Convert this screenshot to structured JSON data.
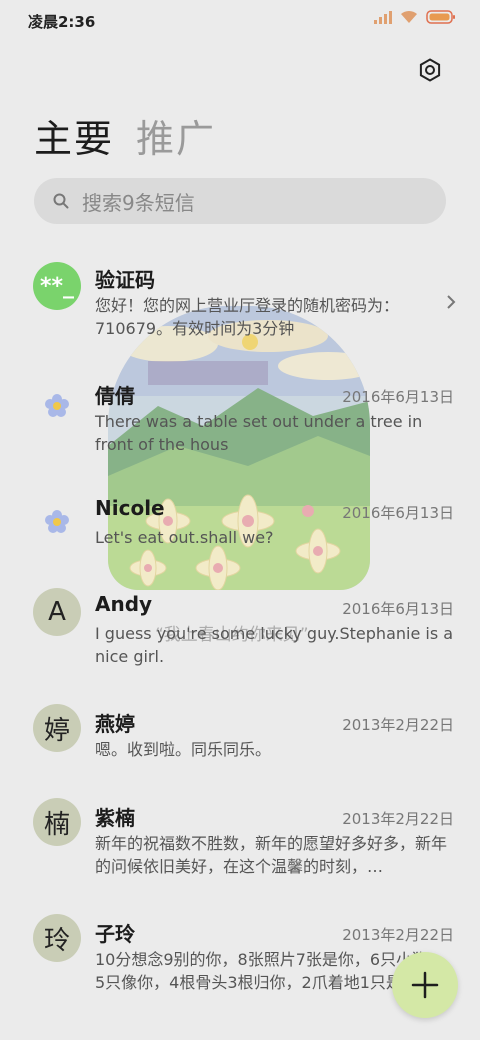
{
  "status_bar": {
    "time": "凌晨2:36",
    "signal_icon": "signal-icon",
    "wifi_icon": "wifi-icon",
    "battery_icon": "battery-icon"
  },
  "header": {
    "settings_icon": "settings-icon"
  },
  "tabs": [
    {
      "label": "主要",
      "active": true
    },
    {
      "label": "推广",
      "active": false
    }
  ],
  "search": {
    "placeholder": "搜索9条短信",
    "icon": "search-icon"
  },
  "conversations": [
    {
      "avatar_text": "**_",
      "name": "验证码",
      "date": "",
      "preview": "您好！您的网上营业厅登录的随机密码为：710679。有效时间为3分钟"
    },
    {
      "avatar_text": "",
      "name": "倩倩",
      "date": "2016年6月13日",
      "preview": "There was a table set out under a tree in front of the hous"
    },
    {
      "avatar_text": "",
      "name": "Nicole",
      "date": "2016年6月13日",
      "preview": "Let's eat out.shall we?"
    },
    {
      "avatar_text": "A",
      "name": "Andy",
      "date": "2016年6月13日",
      "preview": "I guess you're some lucky guy.Stephanie is a nice girl."
    },
    {
      "avatar_text": "婷",
      "name": "燕婷",
      "date": "2013年2月22日",
      "preview": "嗯。收到啦。同乐同乐。"
    },
    {
      "avatar_text": "楠",
      "name": "紫楠",
      "date": "2013年2月22日",
      "preview": "新年的祝福数不胜数，新年的愿望好多好多，新年的问候依旧美好，在这个温馨的时刻，…"
    },
    {
      "avatar_text": "玲",
      "name": "子玲",
      "date": "2013年2月22日",
      "preview": "10分想念9别的你，8张照片7张是你，6只小狗5只像你，4根骨头3根归你，2爪着地1只是你"
    }
  ],
  "overlay": {
    "caption": "“我上春山约你来见”"
  },
  "fab": {
    "icon": "plus-icon"
  },
  "colors": {
    "background": "#ebebeb",
    "fab": "#d4e8a6",
    "avatar_green": "#7ad36c",
    "avatar_grey": "#c9cdb6"
  }
}
